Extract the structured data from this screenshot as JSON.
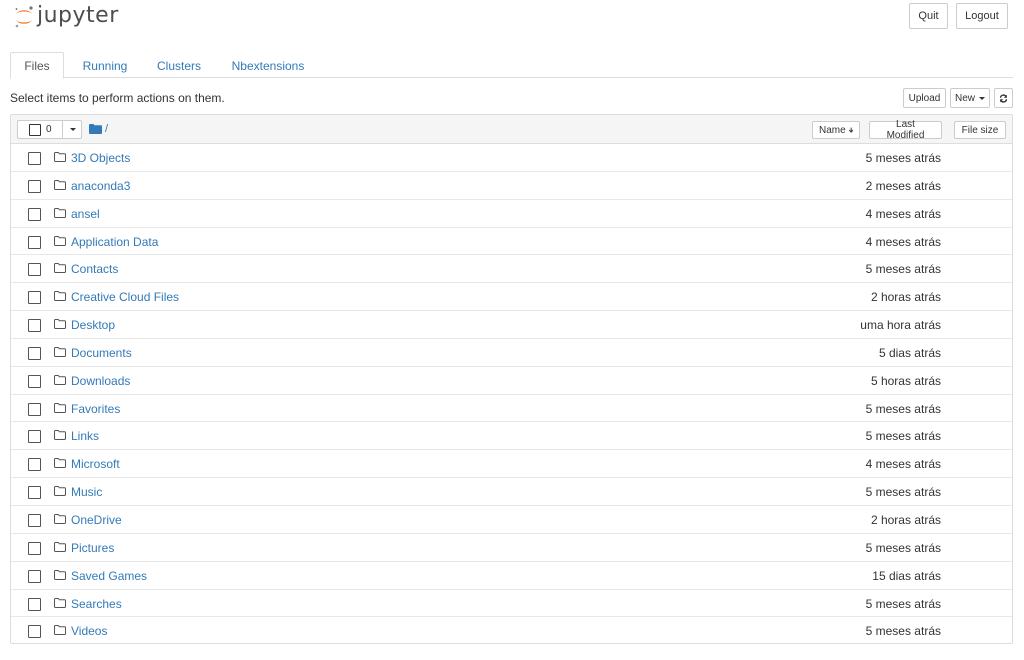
{
  "header": {
    "logo_text": "jupyter",
    "quit_label": "Quit",
    "logout_label": "Logout"
  },
  "tabs": [
    {
      "label": "Files",
      "active": true
    },
    {
      "label": "Running",
      "active": false
    },
    {
      "label": "Clusters",
      "active": false
    },
    {
      "label": "Nbextensions",
      "active": false
    }
  ],
  "toolbar": {
    "instructions": "Select items to perform actions on them.",
    "upload_label": "Upload",
    "new_label": "New",
    "refresh_icon": "refresh-icon"
  },
  "list_header": {
    "selected_count": "0",
    "breadcrumb_sep": "/",
    "sort_name_label": "Name",
    "sort_modified_label": "Last Modified",
    "sort_size_label": "File size"
  },
  "colors": {
    "link": "#337ab7",
    "logo_orange": "#f37726"
  },
  "items": [
    {
      "name": "3D Objects",
      "modified": "5 meses atrás"
    },
    {
      "name": "anaconda3",
      "modified": "2 meses atrás"
    },
    {
      "name": "ansel",
      "modified": "4 meses atrás"
    },
    {
      "name": "Application Data",
      "modified": "4 meses atrás"
    },
    {
      "name": "Contacts",
      "modified": "5 meses atrás"
    },
    {
      "name": "Creative Cloud Files",
      "modified": "2 horas atrás"
    },
    {
      "name": "Desktop",
      "modified": "uma hora atrás"
    },
    {
      "name": "Documents",
      "modified": "5 dias atrás"
    },
    {
      "name": "Downloads",
      "modified": "5 horas atrás"
    },
    {
      "name": "Favorites",
      "modified": "5 meses atrás"
    },
    {
      "name": "Links",
      "modified": "5 meses atrás"
    },
    {
      "name": "Microsoft",
      "modified": "4 meses atrás"
    },
    {
      "name": "Music",
      "modified": "5 meses atrás"
    },
    {
      "name": "OneDrive",
      "modified": "2 horas atrás"
    },
    {
      "name": "Pictures",
      "modified": "5 meses atrás"
    },
    {
      "name": "Saved Games",
      "modified": "15 dias atrás"
    },
    {
      "name": "Searches",
      "modified": "5 meses atrás"
    },
    {
      "name": "Videos",
      "modified": "5 meses atrás"
    }
  ]
}
